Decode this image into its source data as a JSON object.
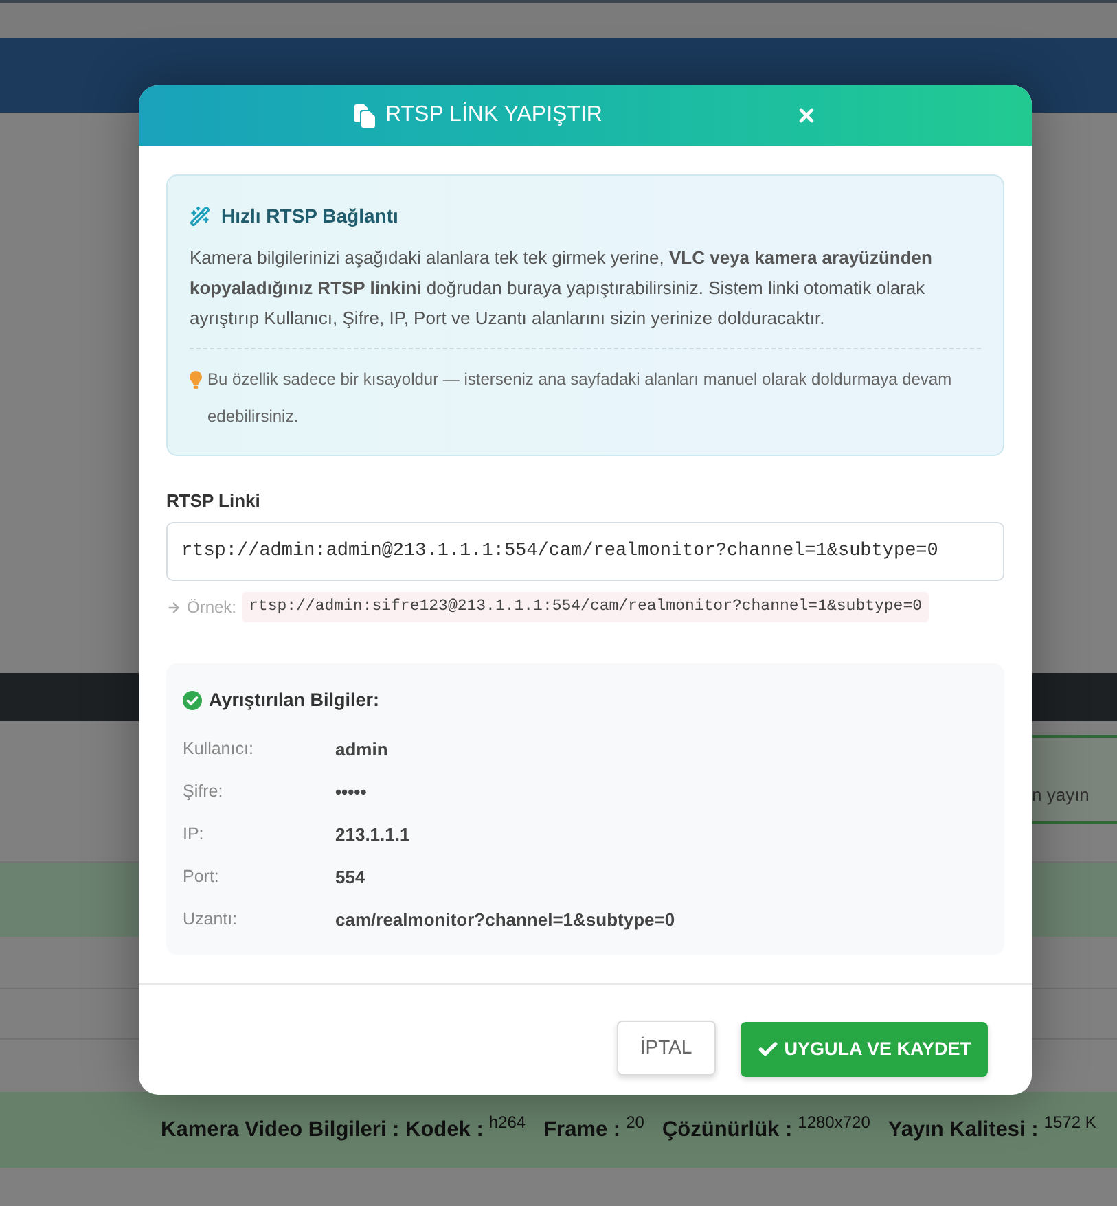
{
  "background_page": {
    "status_text": "n yayın",
    "video_info": [
      {
        "label": "Kamera Video Bilgileri : Kodek :",
        "value": "h264"
      },
      {
        "label": "Frame :",
        "value": "20"
      },
      {
        "label": "Çözünürlük :",
        "value": "1280x720"
      },
      {
        "label": "Yayın Kalitesi :",
        "value": "1572 K"
      }
    ]
  },
  "dialog": {
    "title": "RTSP LİNK YAPIŞTIR",
    "info_box": {
      "title": "Hızlı RTSP Bağlantı",
      "text": "Kamera bilgilerinizi aşağıdaki alanlara tek tek girmek yerine, **VLC veya kamera arayüzünden kopyaladığınız RTSP linkini** doğrudan buraya yapıştırabilirsiniz. Sistem linki otomatik olarak ayrıştırıp Kullanıcı, Şifre, IP, Port ve Uzantı alanlarını sizin yerinize dolduracaktır.",
      "tip": "Bu özellik sadece bir kısayoldur — isterseniz ana sayfadaki alanları manuel olarak doldurmaya devam edebilirsiniz."
    },
    "link_field": {
      "label": "RTSP Linki",
      "value": "rtsp://admin:admin@213.1.1.1:554/cam/realmonitor?channel=1&subtype=0",
      "example_label": "Örnek:",
      "example": "rtsp://admin:sifre123@213.1.1.1:554/cam/realmonitor?channel=1&subtype=0"
    },
    "parsed": {
      "title": "Ayrıştırılan Bilgiler:",
      "rows": [
        {
          "label": "Kullanıcı:",
          "value": "admin"
        },
        {
          "label": "Şifre:",
          "value": "•••••"
        },
        {
          "label": "IP:",
          "value": "213.1.1.1"
        },
        {
          "label": "Port:",
          "value": "554"
        },
        {
          "label": "Uzantı:",
          "value": "cam/realmonitor?channel=1&subtype=0"
        }
      ]
    },
    "buttons": [
      {
        "label": "İPTAL",
        "kind": "secondary"
      },
      {
        "label": "UYGULA VE KAYDET",
        "kind": "primary"
      }
    ]
  }
}
